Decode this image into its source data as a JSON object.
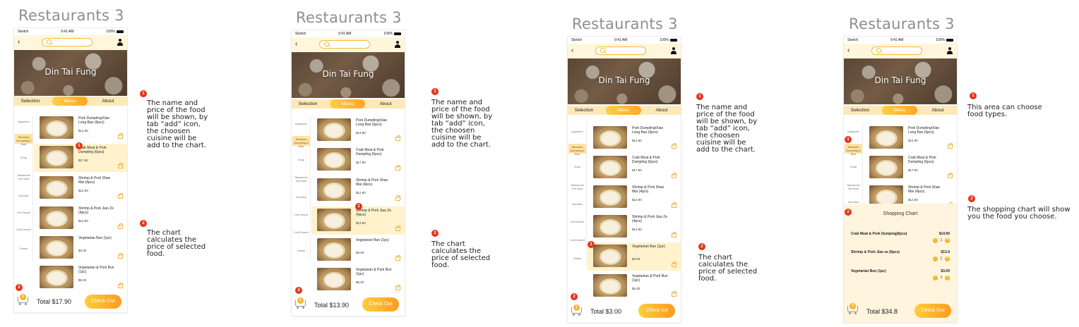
{
  "screens": [
    {
      "title": "Restaurants 3",
      "status": {
        "carrier": "Sketch",
        "time": "9:41 AM",
        "battery": "100%"
      },
      "restaurant": "Din Tai Fung",
      "tabs": [
        "Selection",
        "Menu",
        "About"
      ],
      "categories": [
        "Appetizer",
        "Steamed Dumpling & Bun",
        "Soup",
        "Taiwanese rice style",
        "Noodles",
        "Hot Desert",
        "Cold Desert",
        "Drinks"
      ],
      "items": [
        {
          "name": "Pork Dumpling/Xiao Long Bao  (6pcs)",
          "price": "$14.90"
        },
        {
          "name": "Crab Meat & Pork Dumpling  (6pcs)",
          "price": "$17.90"
        },
        {
          "name": "Shrimp & Pork Shao Mai  (4pcs)",
          "price": "$12.90"
        },
        {
          "name": "Shrimp & Pork Jiao Ze (4pcs)",
          "price": "$13.90"
        },
        {
          "name": "Vegetarian Bun  (1pc)",
          "price": "$3.00"
        },
        {
          "name": "Vegetarian & Pork Bun  (1pc)",
          "price": "$5.00"
        }
      ],
      "cart_count": "1",
      "total": "Total  $17.90",
      "checkout": "Check Out",
      "badges": [
        "1",
        "2"
      ]
    },
    {
      "title": "Restaurants 3",
      "status": {
        "carrier": "Sketch",
        "time": "9:41 AM",
        "battery": "100%"
      },
      "restaurant": "Din Tai Fung",
      "tabs": [
        "Selection",
        "Menu",
        "About"
      ],
      "categories": [
        "Appetizer",
        "Steamed Dumpling & Bun",
        "Soup",
        "Taiwanese rice style",
        "Noodles",
        "Hot Desert",
        "Cold Desert",
        "Drinks"
      ],
      "items": [
        {
          "name": "Pork Dumpling/Xiao Long Bao  (6pcs)",
          "price": "$14.90"
        },
        {
          "name": "Crab Meat & Pork Dumpling  (6pcs)",
          "price": "$17.90"
        },
        {
          "name": "Shrimp & Pork Shao Mai  (4pcs)",
          "price": "$12.90"
        },
        {
          "name": "Shrimp & Pork Jiao Ze (4pcs)",
          "price": "$13.90"
        },
        {
          "name": "Vegetarian Bun  (1pc)",
          "price": "$3.00"
        },
        {
          "name": "Vegetarian & Pork Bun  (1pc)",
          "price": "$5.00"
        }
      ],
      "cart_count": "1",
      "total": "Total  $13.90",
      "checkout": "Check Out",
      "badges": [
        "1",
        "2"
      ]
    },
    {
      "title": "Restaurants 3",
      "status": {
        "carrier": "Sketch",
        "time": "9:41 AM",
        "battery": "100%"
      },
      "restaurant": "Din Tai Fung",
      "tabs": [
        "Selection",
        "Menu",
        "About"
      ],
      "categories": [
        "Appetizer",
        "Steamed Dumpling & Bun",
        "Soup",
        "Taiwanese rice style",
        "Noodles",
        "Hot Desert",
        "Cold Desert",
        "Drinks"
      ],
      "items": [
        {
          "name": "Pork Dumpling/Xiao Long Bao  (6pcs)",
          "price": "$14.90"
        },
        {
          "name": "Crab Meat & Pork Dumpling  (6pcs)",
          "price": "$17.90"
        },
        {
          "name": "Shrimp & Pork Shao Mai  (4pcs)",
          "price": "$12.90"
        },
        {
          "name": "Shrimp & Pork Jiao Ze  (4pcs)",
          "price": "$13.90"
        },
        {
          "name": "Vegetarian Bun  (1pc)",
          "price": "$3.00"
        },
        {
          "name": "Vegetarian & Pork Bun  (1pc)",
          "price": "$5.00"
        }
      ],
      "cart_count": "1",
      "total": "Total  $3.00",
      "checkout": "Check out",
      "badges": [
        "1",
        "2"
      ]
    },
    {
      "title": "Restaurants 3",
      "status": {
        "carrier": "Sketch",
        "time": "9:41 AM",
        "battery": "100%"
      },
      "restaurant": "Din Tai Fung",
      "tabs": [
        "Selection",
        "Menu",
        "About"
      ],
      "categories": [
        "Appetizer",
        "Steamed Dumpling & Bun",
        "Soup",
        "Taiwanese rice style",
        "Noodles"
      ],
      "items": [
        {
          "name": "Pork Dumpling/Xiao Long Bao  (6pcs)",
          "price": "$14.90"
        },
        {
          "name": "Crab Meat & Pork Dumpling  (6pcs)",
          "price": "$17.90"
        },
        {
          "name": "Shrimp & Pork Shao Mai  (4pcs)",
          "price": "$12.90"
        }
      ],
      "shopping_chart": {
        "title": "Shopping Chart",
        "lines": [
          {
            "name": "Crab Meat & Pork Dumping(6pcs)",
            "price": "$14.90",
            "qty": "1"
          },
          {
            "name": "Shrimp & Pork Jiao ze (6pcs)",
            "price": "$13.9",
            "qty": "1"
          },
          {
            "name": "Vegetarian Bun  (1pc)",
            "price": "$3.00",
            "qty": "1"
          }
        ]
      },
      "cart_count": "3",
      "total": "Total  $34.8",
      "checkout": "Check Out",
      "badges": [
        "1",
        "2"
      ]
    }
  ],
  "notes": [
    {
      "badge_1": "1",
      "text_1": "The name and\nprice of the food\nwill be shown, by\ntab “add” icon,\nthe choosen\ncuisine will be\nadd to the chart.",
      "badge_2": "2",
      "text_2": "The chart\ncalculates the\nprice of selected\nfood."
    },
    {
      "badge_1": "1",
      "text_1": "The name and\nprice of the food\nwill be shown, by\ntab “add” icon,\nthe choosen\ncuisine will be\nadd to the chart.",
      "badge_2": "2",
      "text_2": "The chart\ncalculates the\nprice of selected\nfood."
    },
    {
      "badge_1": "1",
      "text_1": "The name and\nprice of the food\nwill be shown, by\ntab “add” icon,\nthe choosen\ncuisine will be\nadd to the chart.",
      "badge_2": "2",
      "text_2": "The chart\ncalculates the\nprice of selected\nfood."
    },
    {
      "badge_1": "1",
      "text_1": "This area can choose\nfood types.",
      "badge_2": "2",
      "text_2": "The shopping chart will show\nyou the food you choose."
    }
  ],
  "colors": {
    "accent": "#ffa726",
    "badge": "#e53419",
    "tabbar": "#fde9b8",
    "highlight": "#fff2cc"
  }
}
